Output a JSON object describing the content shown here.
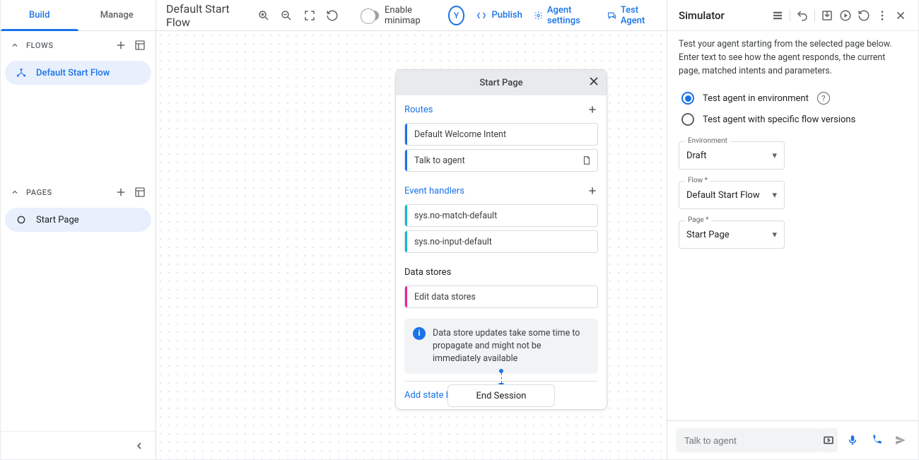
{
  "tabs": {
    "build": "Build",
    "manage": "Manage"
  },
  "sections": {
    "flows_label": "FLOWS",
    "pages_label": "PAGES"
  },
  "flows": [
    {
      "name": "Default Start Flow"
    }
  ],
  "pages": [
    {
      "name": "Start Page"
    }
  ],
  "toolbar": {
    "flow_title": "Default Start Flow",
    "minimap_label": "Enable minimap",
    "avatar_letter": "Y",
    "publish": "Publish",
    "agent_settings": "Agent settings",
    "test_agent": "Test Agent"
  },
  "node": {
    "title": "Start Page",
    "routes_label": "Routes",
    "routes": [
      {
        "label": "Default Welcome Intent"
      },
      {
        "label": "Talk to agent",
        "has_page_icon": true
      }
    ],
    "event_label": "Event handlers",
    "events": [
      {
        "label": "sys.no-match-default"
      },
      {
        "label": "sys.no-input-default"
      }
    ],
    "datastores_label": "Data stores",
    "datastores_item": "Edit data stores",
    "info": "Data store updates take some time to propagate and might not be immediately available",
    "add_state": "Add state handler",
    "end_session": "End Session"
  },
  "simulator": {
    "title": "Simulator",
    "description": "Test your agent starting from the selected page below. Enter text to see how the agent responds, the current page, matched intents and parameters.",
    "radio_env": "Test agent in environment",
    "radio_flow": "Test agent with specific flow versions",
    "fields": {
      "env_label": "Environment",
      "env_value": "Draft",
      "flow_label": "Flow *",
      "flow_value": "Default Start Flow",
      "page_label": "Page *",
      "page_value": "Start Page"
    },
    "input_placeholder": "Talk to agent"
  }
}
